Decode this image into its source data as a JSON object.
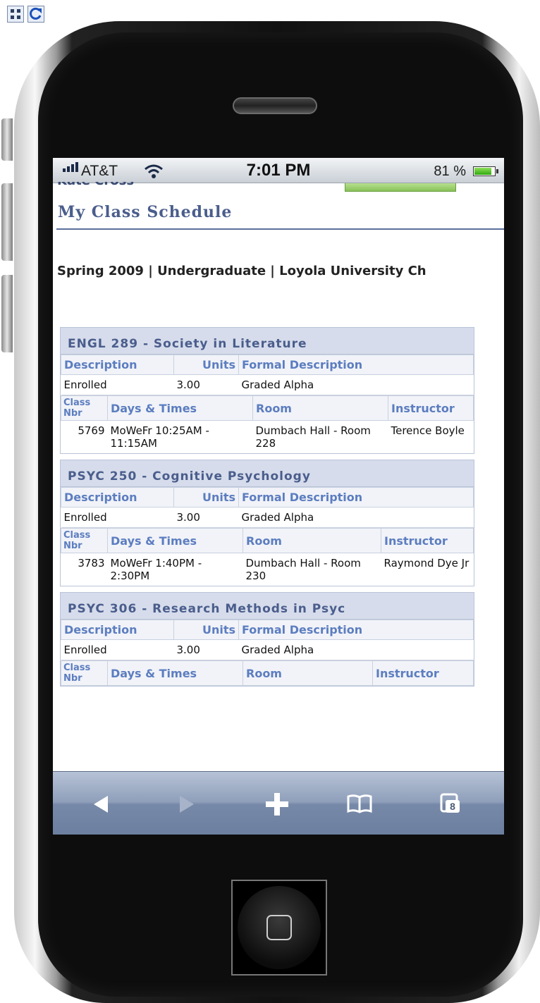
{
  "status_bar": {
    "carrier": "AT&T",
    "time": "7:01 PM",
    "battery": "81 %"
  },
  "page": {
    "cut_header": "Kate Cross",
    "title": "My Class Schedule",
    "term": "Spring 2009 | Undergraduate | Loyola University Ch"
  },
  "headers": {
    "description": "Description",
    "units": "Units",
    "formal": "Formal Description",
    "class_nbr_1": "Class",
    "class_nbr_2": "Nbr",
    "days_times": "Days & Times",
    "room": "Room",
    "instructor": "Instructor"
  },
  "courses": [
    {
      "title": "ENGL 289 - Society in Literature",
      "status": "Enrolled",
      "units": "3.00",
      "formal": "Graded Alpha",
      "class_nbr": "5769",
      "days_times": "MoWeFr 10:25AM - 11:15AM",
      "room": "Dumbach Hall - Room 228",
      "instructor": "Terence Boyle"
    },
    {
      "title": "PSYC 250 - Cognitive Psychology",
      "status": "Enrolled",
      "units": "3.00",
      "formal": "Graded Alpha",
      "class_nbr": "3783",
      "days_times": "MoWeFr 1:40PM - 2:30PM",
      "room": "Dumbach Hall - Room 230",
      "instructor": "Raymond Dye Jr"
    },
    {
      "title": "PSYC 306 - Research Methods in Psyc",
      "status": "Enrolled",
      "units": "3.00",
      "formal": "Graded Alpha"
    }
  ],
  "toolbar": {
    "tabs_count": "8"
  },
  "icons": [
    "grid-icon",
    "refresh-icon",
    "signal-icon",
    "wifi-icon",
    "battery-icon",
    "back-arrow-icon",
    "forward-arrow-icon",
    "add-plus-icon",
    "bookmarks-icon",
    "pages-icon",
    "home-square-icon"
  ],
  "colors": {
    "accent": "#4a5d8c",
    "header_text": "#5c7dc0",
    "table_header_bg": "#d6dceb",
    "toolbar": "#8f9fba"
  }
}
